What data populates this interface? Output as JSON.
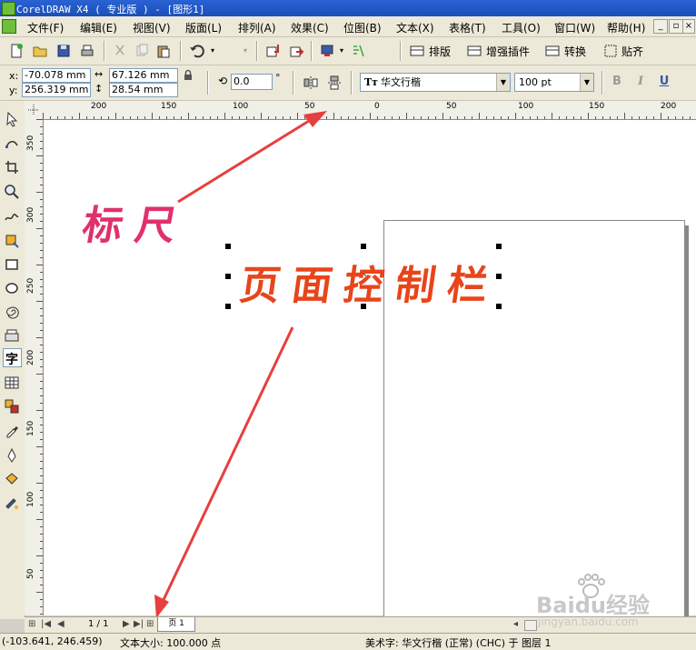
{
  "window": {
    "title": "CorelDRAW X4 ( 专业版 ) - [图形1]"
  },
  "menu": {
    "items": [
      "文件(F)",
      "编辑(E)",
      "视图(V)",
      "版面(L)",
      "排列(A)",
      "效果(C)",
      "位图(B)",
      "文本(X)",
      "表格(T)",
      "工具(O)",
      "窗口(W)",
      "帮助(H)"
    ]
  },
  "toolbar": {
    "layout_label": "排版",
    "plugins_label": "增强插件",
    "convert_label": "转换",
    "align_label": "贴齐"
  },
  "propbar": {
    "x_label": "x:",
    "y_label": "y:",
    "x_value": "-70.078 mm",
    "y_value": "256.319 mm",
    "width_value": "67.126 mm",
    "height_value": "28.54 mm",
    "rotation_value": "0.0",
    "rotation_unit": "°",
    "font_name": "华文行楷",
    "font_size": "100 pt",
    "bold": "B",
    "italic": "I",
    "underline": "U"
  },
  "rulers": {
    "horizontal_ticks": [
      "200",
      "150",
      "100",
      "50",
      "0",
      "50",
      "100",
      "150",
      "200"
    ],
    "vertical_ticks": [
      "350",
      "300",
      "250",
      "200",
      "150",
      "100",
      "50"
    ]
  },
  "canvas": {
    "selected_text": "页面控制栏",
    "annotation_text": "标尺",
    "annotation_color": "#e0306e",
    "text_color": "#e8451a"
  },
  "pagenav": {
    "page_count": "1 / 1",
    "page_tab": "页 1"
  },
  "statusbar": {
    "coords": "(-103.641, 246.459)",
    "text_size": "文本大小: 100.000 点",
    "object_info": "美术字: 华文行楷 (正常) (CHC) 于 图层 1"
  },
  "watermark": {
    "brand": "Baidu经验",
    "url": "jingyan.baidu.com"
  }
}
